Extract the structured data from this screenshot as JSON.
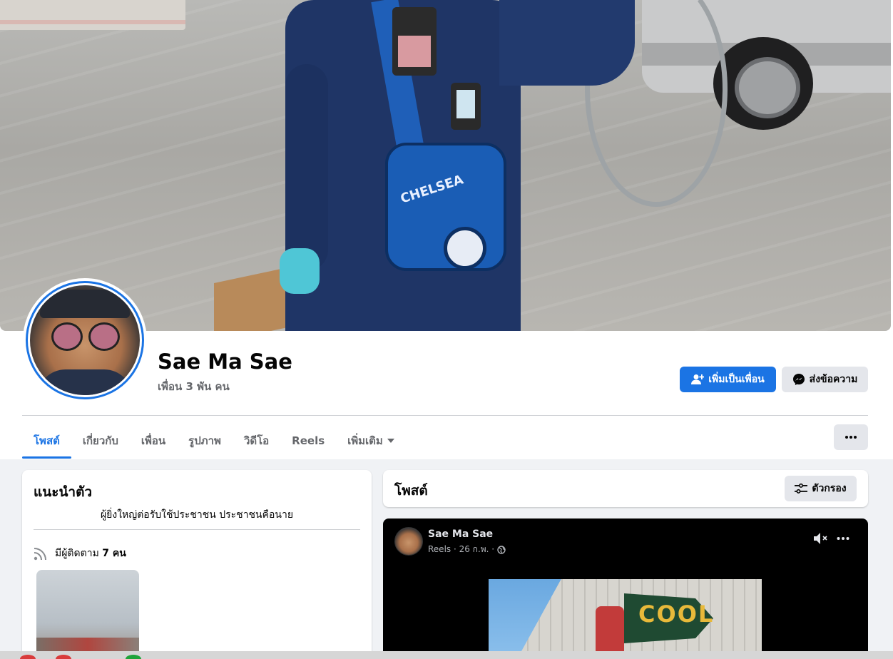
{
  "profile": {
    "name": "Sae Ma Sae",
    "friends": "เพื่อน 3 พัน คน"
  },
  "actions": {
    "add_friend": "เพิ่มเป็นเพื่อน",
    "message": "ส่งข้อความ"
  },
  "tabs": [
    {
      "label": "โพสต์",
      "active": true
    },
    {
      "label": "เกี่ยวกับ"
    },
    {
      "label": "เพื่อน"
    },
    {
      "label": "รูปภาพ"
    },
    {
      "label": "วิดีโอ"
    },
    {
      "label": "Reels"
    },
    {
      "label": "เพิ่มเติม"
    }
  ],
  "intro": {
    "title": "แนะนำตัว",
    "bio": "ผู้ยิ่งใหญ่ต่อรับใช้ประชาชน ประชาชนคือนาย",
    "followers_prefix": "มีผู้ติดตาม ",
    "followers_count": "7 คน"
  },
  "posts": {
    "title": "โพสต์",
    "filter_label": "ตัวกรอง"
  },
  "reel_post": {
    "author": "Sae Ma Sae",
    "meta": "Reels · 26 ก.พ. ·",
    "video_sign": "COOL"
  },
  "colors": {
    "accent": "#1b74e4",
    "button_gray": "#e4e6eb",
    "page_bg": "#f0f2f5"
  },
  "icons": {
    "add_friend": "person-plus-icon",
    "message": "messenger-icon",
    "dropdown": "caret-down-icon",
    "more": "ellipsis-icon",
    "followers": "rss-feed-icon",
    "filter": "sliders-icon",
    "privacy": "globe-icon",
    "mute": "speaker-muted-icon"
  }
}
